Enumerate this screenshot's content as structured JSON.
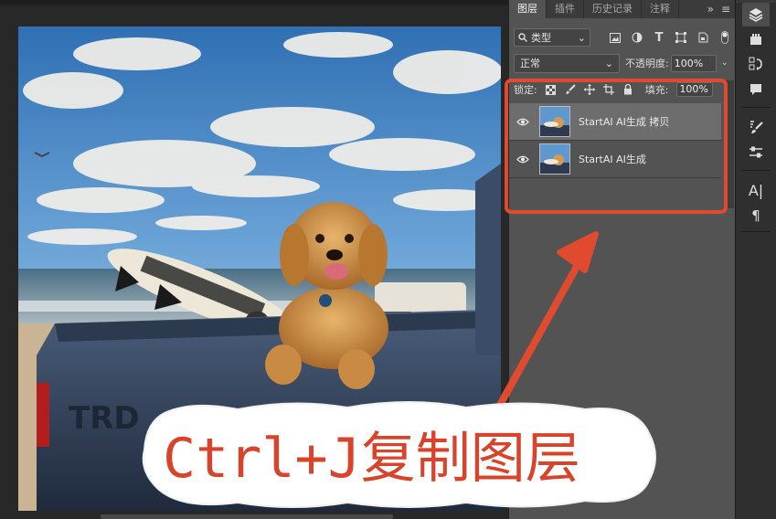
{
  "panel": {
    "tabs": [
      {
        "label": "图层",
        "active": true
      },
      {
        "label": "插件",
        "active": false
      },
      {
        "label": "历史记录",
        "active": false
      },
      {
        "label": "注释",
        "active": false
      }
    ],
    "tab_overflow_icon": "double-chevron-right-icon",
    "menu_icon": "hamburger-menu-icon",
    "filter": {
      "selected": "类型",
      "icons": [
        "image-filter-icon",
        "adjustment-filter-icon",
        "type-filter-icon",
        "shape-filter-icon",
        "smart-object-filter-icon",
        "toggle-filter-icon"
      ]
    },
    "blend_mode": "正常",
    "opacity_label": "不透明度:",
    "opacity_value": "100%",
    "lock_label": "锁定:",
    "fill_label": "填充:",
    "fill_value": "100%",
    "layers": [
      {
        "name": "StartAI AI生成 拷贝",
        "visible": true,
        "selected": true
      },
      {
        "name": "StartAI AI生成",
        "visible": true,
        "selected": false
      }
    ]
  },
  "dock": {
    "buttons": [
      "layers-icon",
      "libraries-icon",
      "history-icon",
      "comment-icon",
      "brushes-icon",
      "adjustments-icon",
      "character-icon",
      "paragraph-icon"
    ]
  },
  "annotation": {
    "caption": "Ctrl+J复制图层",
    "accent_color": "#e04a2e"
  }
}
